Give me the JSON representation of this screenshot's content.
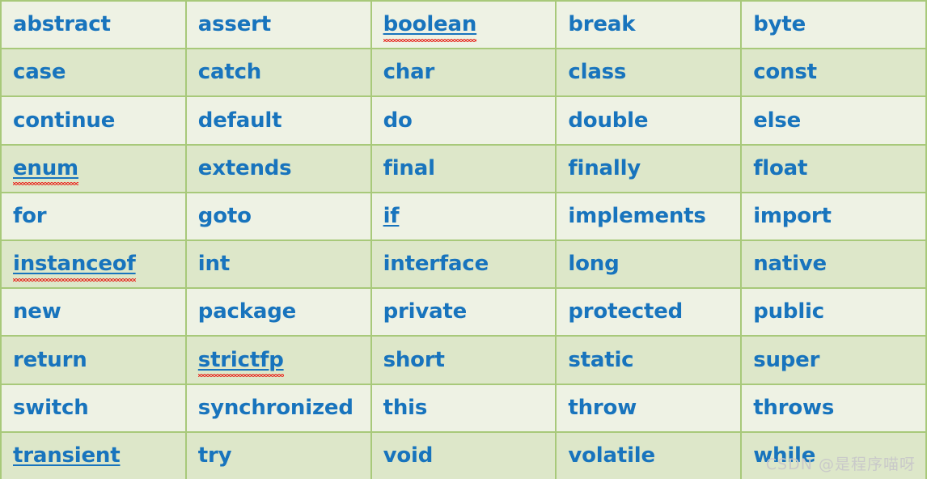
{
  "table": {
    "columns": 5,
    "rows": 10,
    "colors": {
      "row_light": "#eef2e4",
      "row_dark": "#dde7c9",
      "border": "#a8c97a",
      "text": "#1874bd",
      "spellcheck_squiggle": "#e8342a",
      "watermark": "#c9c9c9"
    },
    "cells": [
      {
        "label": "abstract",
        "underline": false,
        "spellcheck": false
      },
      {
        "label": "assert",
        "underline": false,
        "spellcheck": false
      },
      {
        "label": "boolean",
        "underline": true,
        "spellcheck": true
      },
      {
        "label": "break",
        "underline": false,
        "spellcheck": false
      },
      {
        "label": "byte",
        "underline": false,
        "spellcheck": false
      },
      {
        "label": "case",
        "underline": false,
        "spellcheck": false
      },
      {
        "label": "catch",
        "underline": false,
        "spellcheck": false
      },
      {
        "label": "char",
        "underline": false,
        "spellcheck": false
      },
      {
        "label": "class",
        "underline": false,
        "spellcheck": false
      },
      {
        "label": "const",
        "underline": false,
        "spellcheck": false
      },
      {
        "label": "continue",
        "underline": false,
        "spellcheck": false
      },
      {
        "label": "default",
        "underline": false,
        "spellcheck": false
      },
      {
        "label": "do",
        "underline": false,
        "spellcheck": false
      },
      {
        "label": "double",
        "underline": false,
        "spellcheck": false
      },
      {
        "label": "else",
        "underline": false,
        "spellcheck": false
      },
      {
        "label": "enum",
        "underline": true,
        "spellcheck": true
      },
      {
        "label": "extends",
        "underline": false,
        "spellcheck": false
      },
      {
        "label": "final",
        "underline": false,
        "spellcheck": false
      },
      {
        "label": "finally",
        "underline": false,
        "spellcheck": false
      },
      {
        "label": "float",
        "underline": false,
        "spellcheck": false
      },
      {
        "label": "for",
        "underline": false,
        "spellcheck": false
      },
      {
        "label": "goto",
        "underline": false,
        "spellcheck": false
      },
      {
        "label": "if",
        "underline": true,
        "spellcheck": false
      },
      {
        "label": "implements",
        "underline": false,
        "spellcheck": false
      },
      {
        "label": "import",
        "underline": false,
        "spellcheck": false
      },
      {
        "label": "instanceof",
        "underline": true,
        "spellcheck": true
      },
      {
        "label": "int",
        "underline": false,
        "spellcheck": false
      },
      {
        "label": "interface",
        "underline": false,
        "spellcheck": false
      },
      {
        "label": "long",
        "underline": false,
        "spellcheck": false
      },
      {
        "label": "native",
        "underline": false,
        "spellcheck": false
      },
      {
        "label": "new",
        "underline": false,
        "spellcheck": false
      },
      {
        "label": "package",
        "underline": false,
        "spellcheck": false
      },
      {
        "label": "private",
        "underline": false,
        "spellcheck": false
      },
      {
        "label": "protected",
        "underline": false,
        "spellcheck": false
      },
      {
        "label": "public",
        "underline": false,
        "spellcheck": false
      },
      {
        "label": "return",
        "underline": false,
        "spellcheck": false
      },
      {
        "label": "strictfp",
        "underline": true,
        "spellcheck": true
      },
      {
        "label": "short",
        "underline": false,
        "spellcheck": false
      },
      {
        "label": "static",
        "underline": false,
        "spellcheck": false
      },
      {
        "label": "super",
        "underline": false,
        "spellcheck": false
      },
      {
        "label": "switch",
        "underline": false,
        "spellcheck": false
      },
      {
        "label": "synchronized",
        "underline": false,
        "spellcheck": false
      },
      {
        "label": "this",
        "underline": false,
        "spellcheck": false
      },
      {
        "label": "throw",
        "underline": false,
        "spellcheck": false
      },
      {
        "label": "throws",
        "underline": false,
        "spellcheck": false
      },
      {
        "label": "transient",
        "underline": true,
        "spellcheck": false
      },
      {
        "label": "try",
        "underline": false,
        "spellcheck": false
      },
      {
        "label": "void",
        "underline": false,
        "spellcheck": false
      },
      {
        "label": "volatile",
        "underline": false,
        "spellcheck": false
      },
      {
        "label": "while",
        "underline": false,
        "spellcheck": false
      }
    ]
  },
  "watermark": {
    "text": "CSDN @是程序喵呀"
  }
}
